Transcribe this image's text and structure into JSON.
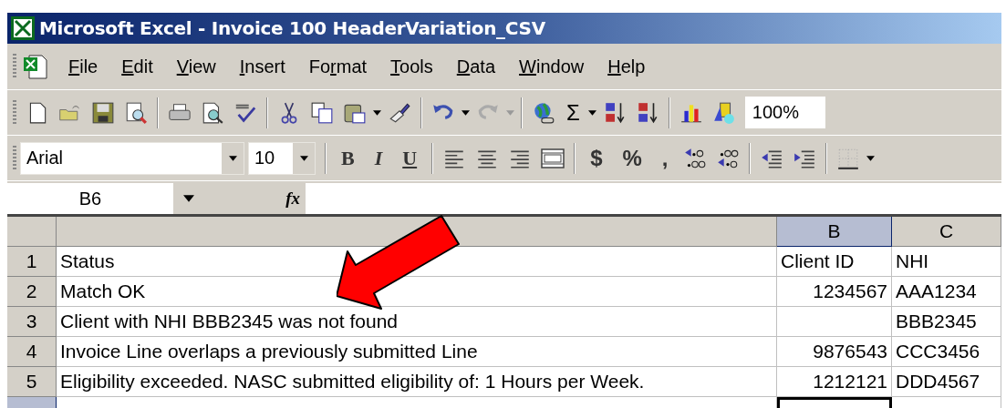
{
  "window": {
    "title": "Microsoft Excel - Invoice 100 HeaderVariation_CSV"
  },
  "menu": [
    {
      "key": "F",
      "after": "ile"
    },
    {
      "key": "E",
      "after": "dit"
    },
    {
      "key": "V",
      "after": "iew"
    },
    {
      "key": "I",
      "after": "nsert"
    },
    {
      "before": "Fo",
      "key": "r",
      "after": "mat"
    },
    {
      "key": "T",
      "after": "ools"
    },
    {
      "key": "D",
      "after": "ata"
    },
    {
      "key": "W",
      "after": "indow"
    },
    {
      "key": "H",
      "after": "elp"
    }
  ],
  "standard_toolbar": {
    "sum_symbol": "Σ",
    "zoom": "100%"
  },
  "format_toolbar": {
    "font": "Arial",
    "size": "10",
    "bold": "B",
    "italic": "I",
    "underline": "U",
    "currency": "$",
    "percent": "%",
    "comma": ","
  },
  "formula_bar": {
    "name_box": "B6",
    "fx": "fx"
  },
  "columns": [
    {
      "selected": false
    },
    {
      "label": "B",
      "selected": true
    },
    {
      "label": "C",
      "selected": false
    }
  ],
  "rows": [
    {
      "number": "1",
      "selected": false,
      "cells": [
        {
          "text": "Status",
          "kind": "text"
        },
        {
          "text": "Client ID",
          "kind": "text"
        },
        {
          "text": "NHI",
          "kind": "text"
        }
      ]
    },
    {
      "number": "2",
      "selected": false,
      "cells": [
        {
          "text": "Match OK",
          "kind": "text"
        },
        {
          "text": "1234567",
          "kind": "number"
        },
        {
          "text": "AAA1234",
          "kind": "text"
        }
      ]
    },
    {
      "number": "3",
      "selected": false,
      "cells": [
        {
          "text": "Client with NHI BBB2345 was not found",
          "kind": "text"
        },
        {
          "kind": "number"
        },
        {
          "text": "BBB2345",
          "kind": "text"
        }
      ]
    },
    {
      "number": "4",
      "selected": false,
      "cells": [
        {
          "text": "Invoice Line overlaps a previously submitted Line",
          "kind": "text"
        },
        {
          "text": "9876543",
          "kind": "number"
        },
        {
          "text": "CCC3456",
          "kind": "text"
        }
      ]
    },
    {
      "number": "5",
      "selected": false,
      "cells": [
        {
          "text": "Eligibility exceeded. NASC submitted eligibility of: 1 Hours per Week.",
          "kind": "text"
        },
        {
          "text": "1212121",
          "kind": "number"
        },
        {
          "text": "DDD4567",
          "kind": "text"
        }
      ]
    },
    {
      "selected": true,
      "cells": [
        {
          "active": false
        },
        {
          "active": true
        },
        {
          "active": false
        }
      ]
    }
  ]
}
